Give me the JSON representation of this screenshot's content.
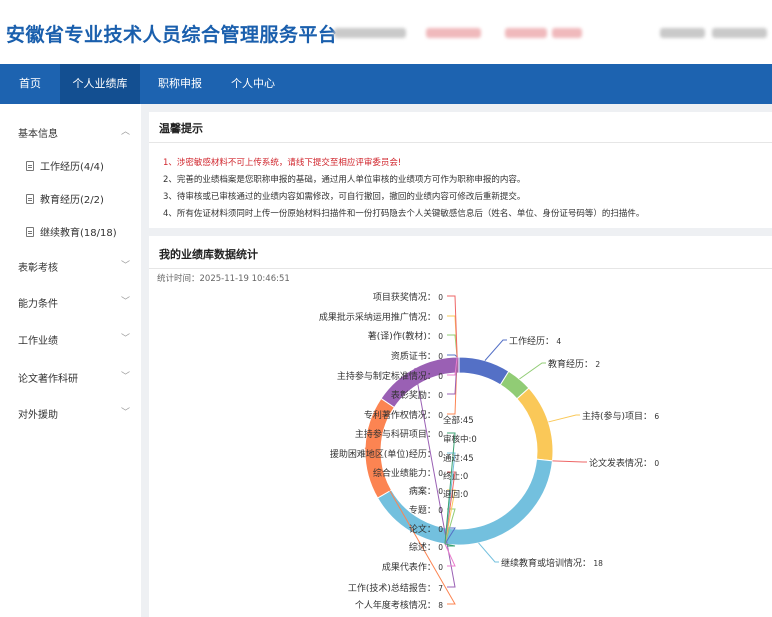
{
  "header": {
    "title": "安徽省专业技术人员综合管理服务平台"
  },
  "nav": {
    "items": [
      {
        "label": "首页",
        "active": false
      },
      {
        "label": "个人业绩库",
        "active": true
      },
      {
        "label": "职称申报",
        "active": false
      },
      {
        "label": "个人中心",
        "active": false
      }
    ]
  },
  "sidebar": {
    "basic_info": "基本信息",
    "sub_items": [
      "工作经历(4/4)",
      "教育经历(2/2)",
      "继续教育(18/18)"
    ],
    "groups": [
      "表彰考核",
      "能力条件",
      "工作业绩",
      "论文著作科研",
      "对外援助"
    ]
  },
  "notice": {
    "title": "温馨提示",
    "lines": [
      "1、涉密敏感材料不可上传系统，请线下提交至相应评审委员会!",
      "2、完善的业绩档案是您职称申报的基础，通过用人单位审核的业绩项方可作为职称申报的内容。",
      "3、待审核或已审核通过的业绩内容如需修改，可自行撤回，撤回的业绩内容可修改后重新提交。",
      "4、所有佐证材料须同时上传一份原始材料扫描件和一份打码隐去个人关键敏感信息后（姓名、单位、身份证号码等）的扫描件。"
    ]
  },
  "stats": {
    "title": "我的业绩库数据统计",
    "time": "统计时间：2025-11-19 10:46:51",
    "center": {
      "total": "全部:45",
      "pending": "审核中:0",
      "passed": "通过:45",
      "terminated": "终止:0",
      "returned": "退回:0"
    }
  },
  "chart_data": {
    "type": "pie",
    "donut": true,
    "slices": [
      {
        "name": "工作经历",
        "value": 4,
        "color": "#5470c6"
      },
      {
        "name": "教育经历",
        "value": 2,
        "color": "#91cc75"
      },
      {
        "name": "主持(参与)项目",
        "value": 6,
        "color": "#fac858"
      },
      {
        "name": "论文发表情况",
        "value": 0,
        "color": "#ee6666"
      },
      {
        "name": "继续教育或培训情况",
        "value": 18,
        "color": "#73c0de"
      },
      {
        "name": "个人年度考核情况",
        "value": 8,
        "color": "#fc8452"
      },
      {
        "name": "工作(技术)总结报告",
        "value": 7,
        "color": "#9a60b4"
      },
      {
        "name": "成果代表作",
        "value": 0,
        "color": "#ea7ccc"
      },
      {
        "name": "综述",
        "value": 0,
        "color": "#3ba272"
      },
      {
        "name": "论文",
        "value": 0,
        "color": "#5470c6"
      },
      {
        "name": "专题",
        "value": 0,
        "color": "#91cc75"
      },
      {
        "name": "病案",
        "value": 0,
        "color": "#fac858"
      },
      {
        "name": "综合业绩能力",
        "value": 0,
        "color": "#ee6666"
      },
      {
        "name": "援助困难地区(单位)经历",
        "value": 0,
        "color": "#73c0de"
      },
      {
        "name": "主持参与科研项目",
        "value": 0,
        "color": "#3ba272"
      },
      {
        "name": "专利著作权情况",
        "value": 0,
        "color": "#fc8452"
      },
      {
        "name": "表彰奖励",
        "value": 0,
        "color": "#9a60b4"
      },
      {
        "name": "主持参与制定标准情况",
        "value": 0,
        "color": "#ea7ccc"
      },
      {
        "name": "资质证书",
        "value": 0,
        "color": "#5470c6"
      },
      {
        "name": "著(译)作(教材)",
        "value": 0,
        "color": "#91cc75"
      },
      {
        "name": "成果批示采纳运用推广情况",
        "value": 0,
        "color": "#fac858"
      },
      {
        "name": "项目获奖情况",
        "value": 0,
        "color": "#ee6666"
      }
    ]
  }
}
